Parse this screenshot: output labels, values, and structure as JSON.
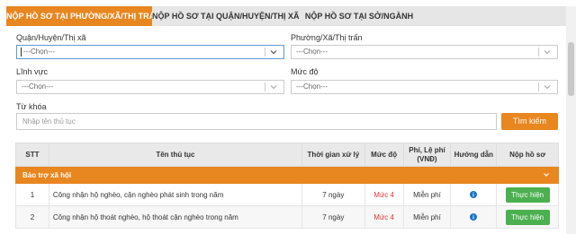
{
  "tabs": [
    {
      "label": "NỘP HỒ SƠ TẠI PHƯỜNG/XÃ/THỊ TRẤN"
    },
    {
      "label": "NỘP HỒ SƠ TẠI QUẬN/HUYỆN/THỊ XÃ"
    },
    {
      "label": "NỘP HỒ SƠ TẠI SỞ/NGÀNH"
    }
  ],
  "filters": {
    "district": {
      "label": "Quận/Huyện/Thị xã",
      "value": "---Chọn---"
    },
    "ward": {
      "label": "Phường/Xã/Thị trấn",
      "value": "---Chọn---"
    },
    "field": {
      "label": "Lĩnh vực",
      "value": "---Chọn---"
    },
    "level": {
      "label": "Mức độ",
      "value": "---Chọn---"
    },
    "keyword": {
      "label": "Từ khóa",
      "placeholder": "Nhập tên thủ tục"
    },
    "search_button": "Tìm kiếm"
  },
  "table": {
    "headers": [
      "STT",
      "Tên thủ tục",
      "Thời gian xử lý",
      "Mức độ",
      "Phí, Lệ phí (VNĐ)",
      "Hướng dẫn",
      "Nộp hồ sơ"
    ],
    "group": "Bảo trợ xã hội",
    "rows": [
      {
        "stt": "1",
        "name": "Công nhận hộ nghèo, cận nghèo phát sinh trong năm",
        "time": "7 ngày",
        "level": "Mức 4",
        "fee": "Miễn phí",
        "action": "Thực hiện"
      },
      {
        "stt": "2",
        "name": "Công nhận hộ thoát nghèo, hộ thoát cận nghèo trong năm",
        "time": "7 ngày",
        "level": "Mức 4",
        "fee": "Miễn phí",
        "action": "Thực hiện"
      }
    ]
  },
  "colors": {
    "accent": "#e8861f",
    "success": "#4caf50",
    "level": "#d9383a",
    "info": "#1a73c8"
  },
  "icons": {
    "select": "chevron-down-icon",
    "info": "info-icon",
    "group": "chevron-down-icon"
  }
}
